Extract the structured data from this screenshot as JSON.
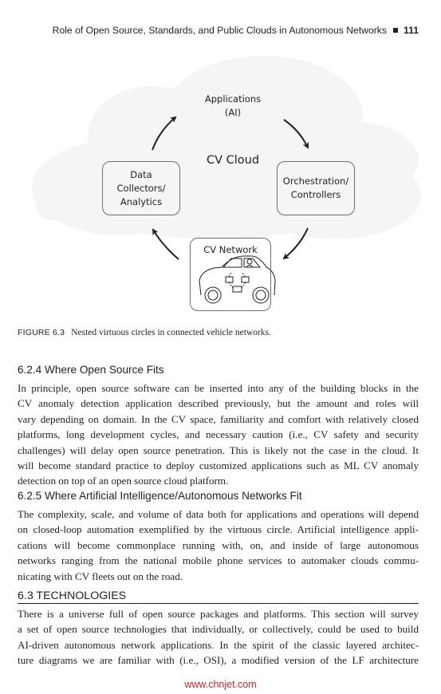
{
  "running_head": {
    "title": "Role of Open Source, Standards, and Public Clouds in Autonomous Networks",
    "page_number": "111"
  },
  "figure": {
    "cloud_label": "CV Cloud",
    "applications": [
      "Applications",
      "(AI)"
    ],
    "data_collectors": [
      "Data",
      "Collectors/",
      "Analytics"
    ],
    "orchestration": [
      "Orchestration/",
      "Controllers"
    ],
    "cv_network": "CV Network",
    "icons": [
      "cloud-shape",
      "curved-arrow",
      "car-icon",
      "driver-icon"
    ],
    "colors": {
      "cloud_fill": "#f4f5f5",
      "box_border": "#6d6e71",
      "arrow": "#231f20"
    },
    "caption_label": "FIGURE 6.3",
    "caption_text": "Nested virtuous circles in connected vehicle networks."
  },
  "sections": [
    {
      "heading": "6.2.4  Where Open Source Fits",
      "lines": [
        "In principle, open source software can be inserted into any of the building blocks in the",
        "CV anomaly detection application described previously, but the amount and roles will",
        "vary depending on domain. In the CV space, familiarity and comfort with relatively closed",
        "platforms, long development cycles, and necessary caution (i.e., CV safety and security",
        "challenges) will delay open source penetration. This is likely not the case in the cloud. It",
        "will become standard practice to deploy customized applications such as ML CV anomaly",
        "detection on top of an open source cloud platform."
      ]
    },
    {
      "heading": "6.2.5  Where Artificial Intelligence/Autonomous Networks Fit",
      "lines": [
        "The complexity, scale, and volume of data both for applications and operations will depend",
        "on closed-loop automation exemplified by the virtuous circle. Artificial intelligence appli-",
        "cations will become commonplace running with, on, and inside of large autonomous",
        "networks ranging from the national mobile phone services to automaker clouds commu-",
        "nicating with CV fleets out on the road."
      ]
    },
    {
      "heading": "6.3  TECHNOLOGIES",
      "lines": [
        "There is a universe full of open source packages and platforms. This section will survey",
        "a set of open source technologies that individually, or collectively, could be used to build",
        "AI-driven autonomous network applications. In the spirit of the classic layered architec-",
        "ture diagrams we are familiar with (i.e., OSI), a modified version of the LF architecture"
      ]
    }
  ],
  "watermark": "www.chnjet.com"
}
